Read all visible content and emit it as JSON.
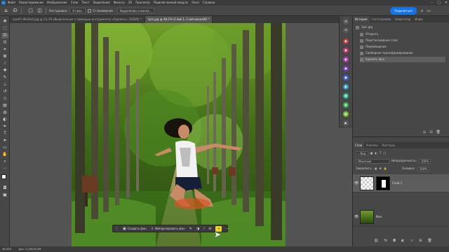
{
  "menubar": {
    "logo": "Ps",
    "items": [
      "Файл",
      "Редактирование",
      "Изображение",
      "Слои",
      "Текст",
      "Выделение",
      "Фильтр",
      "3D",
      "Просмотр",
      "Подключаемый модуль",
      "Окно",
      "Справка"
    ]
  },
  "options": {
    "feather_label": "Растушевка:",
    "feather_value": "0 пикс.",
    "antialias_label": "Сглаживание",
    "select_mask_label": "Выделение и маска..."
  },
  "share_label": "Поделиться",
  "tabs": [
    {
      "label": "али#1-MivDo0.jpg @ 33,3% (Выделенные с помощью инструмента «Удалить», RGB/8) *",
      "active": false
    },
    {
      "label": "1рic.jpg @ 48,1% (Слой 1, Слой-маска/8) *",
      "active": true
    }
  ],
  "context_bar": {
    "create_bg": "Создать фон",
    "import_bg": "Импортировать фон"
  },
  "status": {
    "zoom": "48,05%",
    "doc": "Док: 11,0M/35,0M"
  },
  "right_panel": {
    "history_tabs": [
      "История",
      "Гистограмма",
      "Навигатор",
      "Инфо"
    ],
    "history_file": "1рic.jpg",
    "history_items": [
      "Открыть",
      "Перетаскивание слоя",
      "Перемещение",
      "Свободное трансформирование",
      "Удалить фон"
    ],
    "layers_tabs": [
      "Слои",
      "Каналы",
      "Контуры"
    ],
    "kind_label": "Вид",
    "blend_mode": "Обычные",
    "opacity_label": "Непрозрачность:",
    "opacity_value": "100%",
    "lock_label": "Закрепить:",
    "fill_label": "Заливка:",
    "fill_value": "100%",
    "layers": [
      {
        "name": "Слой 1",
        "selected": true
      },
      {
        "name": "Фон",
        "selected": false
      }
    ]
  },
  "colors": {
    "accent": "#1473e6",
    "highlight": "#f1d31c"
  }
}
